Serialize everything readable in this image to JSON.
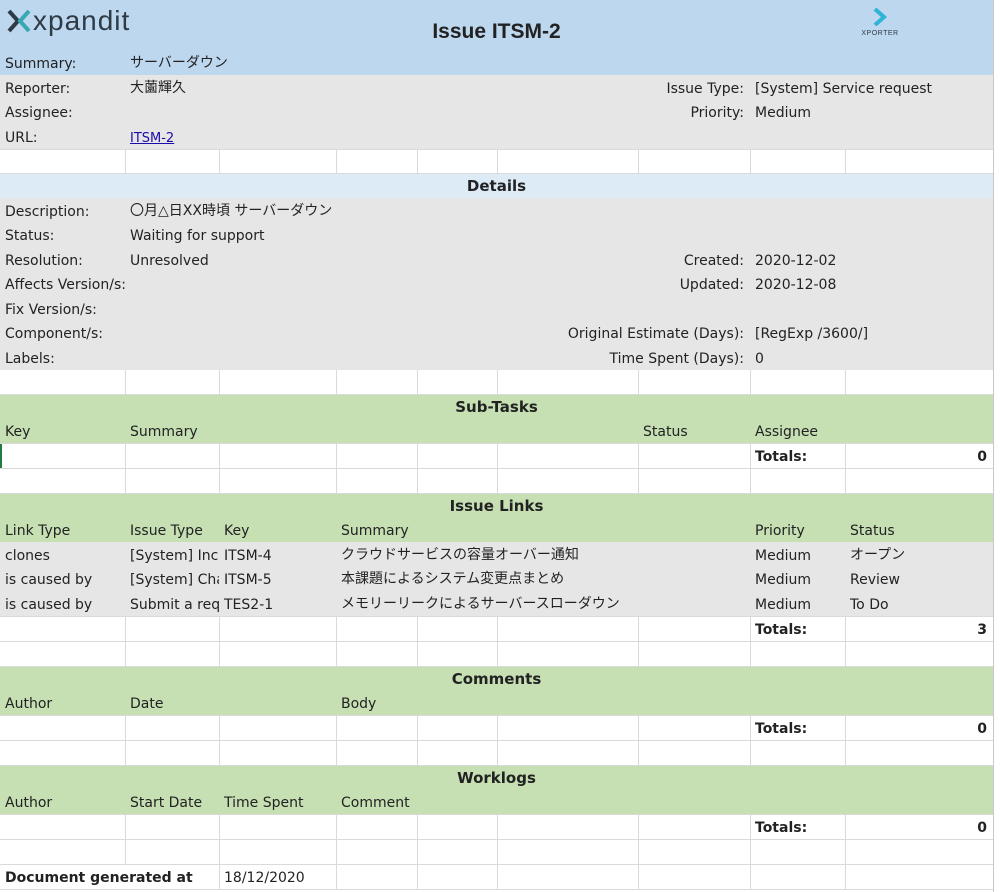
{
  "header": {
    "logo_text": "xpandit",
    "title": "Issue ITSM-2",
    "xporter_label": "XPORTER",
    "summary_label": "Summary:",
    "summary_value": "サーバーダウン"
  },
  "info": {
    "reporter_label": "Reporter:",
    "reporter_value": "大薗輝久",
    "assignee_label": "Assignee:",
    "assignee_value": "",
    "url_label": "URL:",
    "url_value": "ITSM-2",
    "issue_type_label": "Issue Type:",
    "issue_type_value": "[System] Service request",
    "priority_label": "Priority:",
    "priority_value": "Medium"
  },
  "details": {
    "title": "Details",
    "description_label": "Description:",
    "description_value": "〇月△日XX時頃 サーバーダウン",
    "status_label": "Status:",
    "status_value": "Waiting for support",
    "resolution_label": "Resolution:",
    "resolution_value": "Unresolved",
    "affects_label": "Affects Version/s:",
    "fix_label": "Fix Version/s:",
    "component_label": "Component/s:",
    "labels_label": "Labels:",
    "created_label": "Created:",
    "created_value": "2020-12-02",
    "updated_label": "Updated:",
    "updated_value": "2020-12-08",
    "estimate_label": "Original Estimate (Days):",
    "estimate_value": "[RegExp /3600/]",
    "spent_label": "Time Spent (Days):",
    "spent_value": "0"
  },
  "subtasks": {
    "title": "Sub-Tasks",
    "col_key": "Key",
    "col_summary": "Summary",
    "col_status": "Status",
    "col_assignee": "Assignee",
    "totals_label": "Totals:",
    "totals_value": "0"
  },
  "issue_links": {
    "title": "Issue Links",
    "col_link_type": "Link Type",
    "col_issue_type": "Issue Type",
    "col_key": "Key",
    "col_summary": "Summary",
    "col_priority": "Priority",
    "col_status": "Status",
    "rows": [
      {
        "link_type": "clones",
        "issue_type": "[System] Inci",
        "key": "ITSM-4",
        "summary": "クラウドサービスの容量オーバー通知",
        "priority": "Medium",
        "status": "オープン"
      },
      {
        "link_type": "is caused by",
        "issue_type": "[System] Cha",
        "key": "ITSM-5",
        "summary": "本課題によるシステム変更点まとめ",
        "priority": "Medium",
        "status": "Review"
      },
      {
        "link_type": "is caused by",
        "issue_type": "Submit a req",
        "key": "TES2-1",
        "summary": "メモリーリークによるサーバースローダウン",
        "priority": "Medium",
        "status": "To Do"
      }
    ],
    "totals_label": "Totals:",
    "totals_value": "3"
  },
  "comments": {
    "title": "Comments",
    "col_author": "Author",
    "col_date": "Date",
    "col_body": "Body",
    "totals_label": "Totals:",
    "totals_value": "0"
  },
  "worklogs": {
    "title": "Worklogs",
    "col_author": "Author",
    "col_start_date": "Start Date",
    "col_time_spent": "Time Spent",
    "col_comment": "Comment",
    "totals_label": "Totals:",
    "totals_value": "0"
  },
  "footer": {
    "generated_label": "Document generated at",
    "generated_value": "18/12/2020"
  },
  "colors": {
    "header_blue": "#bdd7ee",
    "details_blue": "#ddebf7",
    "grey": "#e7e6e6",
    "green": "#c6e0b4",
    "white": "#ffffff",
    "xporter_accent": "#2fb3d6",
    "logo_dark": "#2e3a46",
    "logo_teal": "#3aa7b5"
  }
}
